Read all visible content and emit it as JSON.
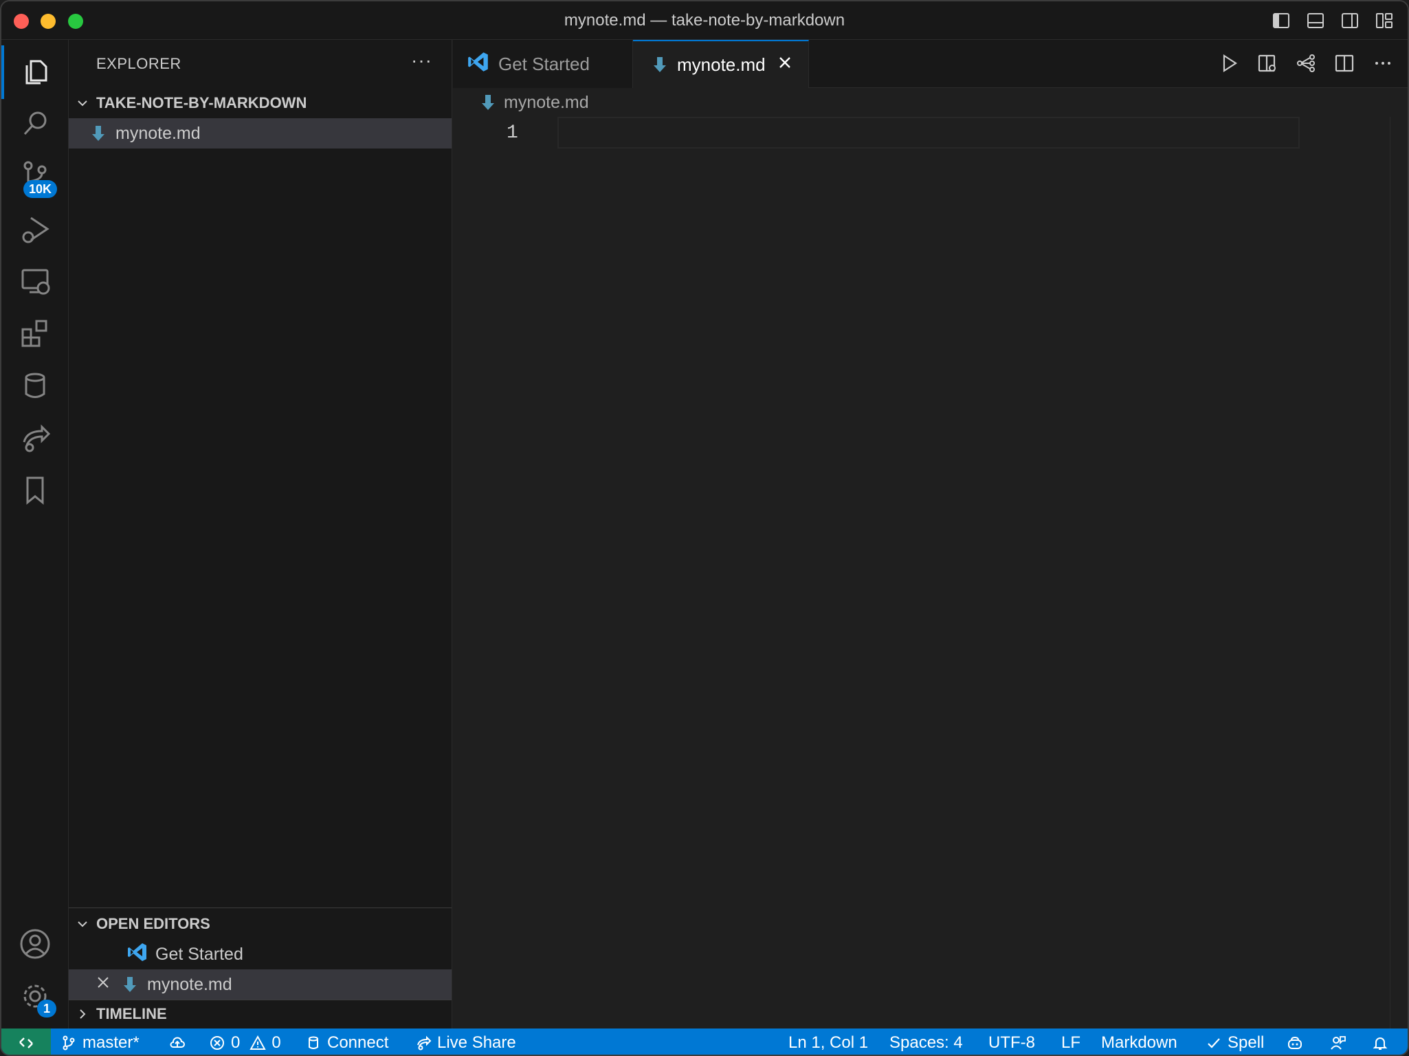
{
  "window": {
    "title": "mynote.md — take-note-by-markdown"
  },
  "activity_bar": {
    "source_control_badge": "10K",
    "settings_badge": "1"
  },
  "sidebar": {
    "header": "EXPLORER",
    "more": "···",
    "folder": {
      "name": "TAKE-NOTE-BY-MARKDOWN",
      "files": [
        "mynote.md"
      ]
    },
    "open_editors": {
      "title": "OPEN EDITORS",
      "items": [
        "Get Started",
        "mynote.md"
      ]
    },
    "timeline": {
      "title": "TIMELINE"
    }
  },
  "editor": {
    "tabs": [
      {
        "label": "Get Started",
        "active": false
      },
      {
        "label": "mynote.md",
        "active": true
      }
    ],
    "breadcrumb": "mynote.md",
    "line_numbers": [
      "1"
    ]
  },
  "status_bar": {
    "branch": "master*",
    "errors": "0",
    "warnings": "0",
    "connect": "Connect",
    "live_share": "Live Share",
    "position": "Ln 1, Col 1",
    "spaces": "Spaces: 4",
    "encoding": "UTF-8",
    "eol": "LF",
    "language": "Markdown",
    "spell": "Spell"
  },
  "colors": {
    "accent": "#0078d4",
    "remote": "#16825d",
    "markdown_icon": "#519aba"
  }
}
